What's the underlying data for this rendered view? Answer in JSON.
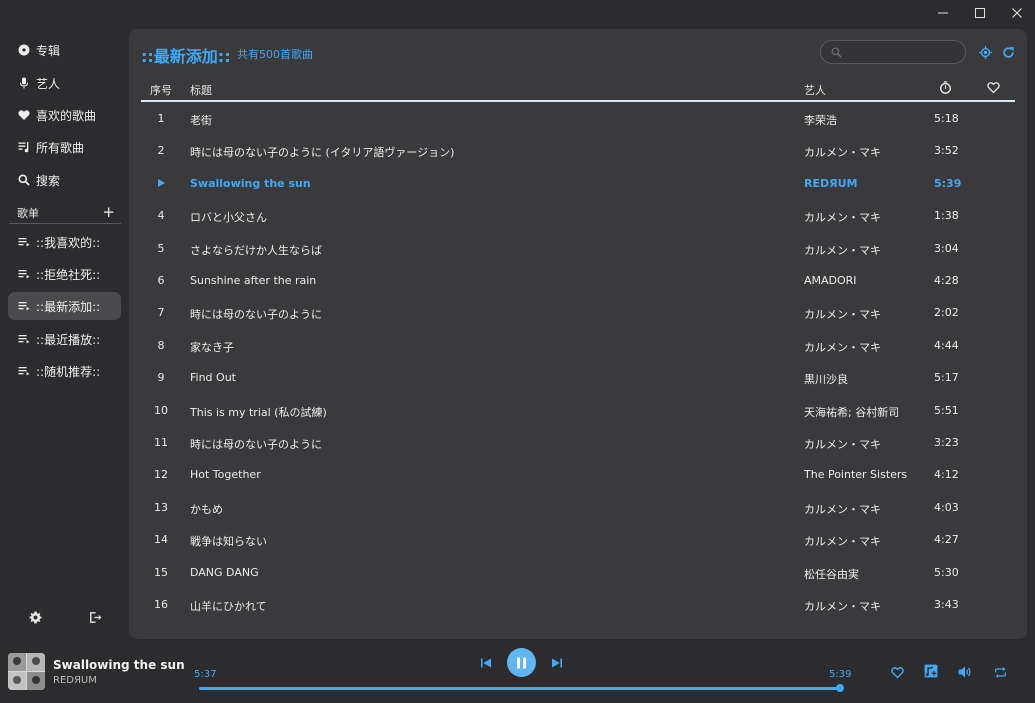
{
  "sidebar": {
    "nav": [
      {
        "label": "专辑",
        "icon": "disc-icon"
      },
      {
        "label": "艺人",
        "icon": "microphone-icon"
      },
      {
        "label": "喜欢的歌曲",
        "icon": "heart-icon"
      },
      {
        "label": "所有歌曲",
        "icon": "music-list-icon"
      },
      {
        "label": "搜索",
        "icon": "search-icon"
      }
    ],
    "playlists_header": "歌单",
    "playlists": [
      {
        "label": "::我喜欢的::"
      },
      {
        "label": "::拒绝社死::"
      },
      {
        "label": "::最新添加::",
        "active": true
      },
      {
        "label": "::最近播放::"
      },
      {
        "label": "::随机推荐::"
      }
    ]
  },
  "main": {
    "title": "::最新添加::",
    "subtitle": "共有500首歌曲",
    "search": {
      "placeholder": "",
      "value": ""
    },
    "columns": {
      "index": "序号",
      "title": "标题",
      "artist": "艺人",
      "duration_icon": "timer-icon",
      "like_icon": "heart-outline-icon"
    },
    "rows": [
      {
        "index": "1",
        "title": "老街",
        "artist": "李荣浩",
        "duration": "5:18"
      },
      {
        "index": "2",
        "title": "時には母のない子のように (イタリア語ヴァージョン)",
        "artist": "カルメン・マキ",
        "duration": "3:52"
      },
      {
        "index": "",
        "title": "Swallowing the sun",
        "artist": "REDЯUM",
        "duration": "5:39",
        "playing": true
      },
      {
        "index": "4",
        "title": "ロバと小父さん",
        "artist": "カルメン・マキ",
        "duration": "1:38"
      },
      {
        "index": "5",
        "title": "さよならだけか人生ならば",
        "artist": "カルメン・マキ",
        "duration": "3:04"
      },
      {
        "index": "6",
        "title": "Sunshine after the rain",
        "artist": "AMADORI",
        "duration": "4:28"
      },
      {
        "index": "7",
        "title": "時には母のない子のように",
        "artist": "カルメン・マキ",
        "duration": "2:02"
      },
      {
        "index": "8",
        "title": "家なき子",
        "artist": "カルメン・マキ",
        "duration": "4:44"
      },
      {
        "index": "9",
        "title": "Find Out",
        "artist": "黒川沙良",
        "duration": "5:17"
      },
      {
        "index": "10",
        "title": "This is my trial (私の試練)",
        "artist": "天海祐希; 谷村新司",
        "duration": "5:51"
      },
      {
        "index": "11",
        "title": "時には母のない子のように",
        "artist": "カルメン・マキ",
        "duration": "3:23"
      },
      {
        "index": "12",
        "title": "Hot Together",
        "artist": "The Pointer Sisters",
        "duration": "4:12"
      },
      {
        "index": "13",
        "title": "かもめ",
        "artist": "カルメン・マキ",
        "duration": "4:03"
      },
      {
        "index": "14",
        "title": "戦争は知らない",
        "artist": "カルメン・マキ",
        "duration": "4:27"
      },
      {
        "index": "15",
        "title": "DANG DANG",
        "artist": "松任谷由実",
        "duration": "5:30"
      },
      {
        "index": "16",
        "title": "山羊にひかれて",
        "artist": "カルメン・マキ",
        "duration": "3:43"
      }
    ]
  },
  "player": {
    "title": "Swallowing the sun",
    "artist": "REDЯUM",
    "elapsed": "5:37",
    "total": "5:39",
    "progress_fraction": 0.994
  },
  "colors": {
    "accent": "#3fa9f5",
    "background": "#2c2c2e",
    "panel": "#3a3a3c"
  }
}
